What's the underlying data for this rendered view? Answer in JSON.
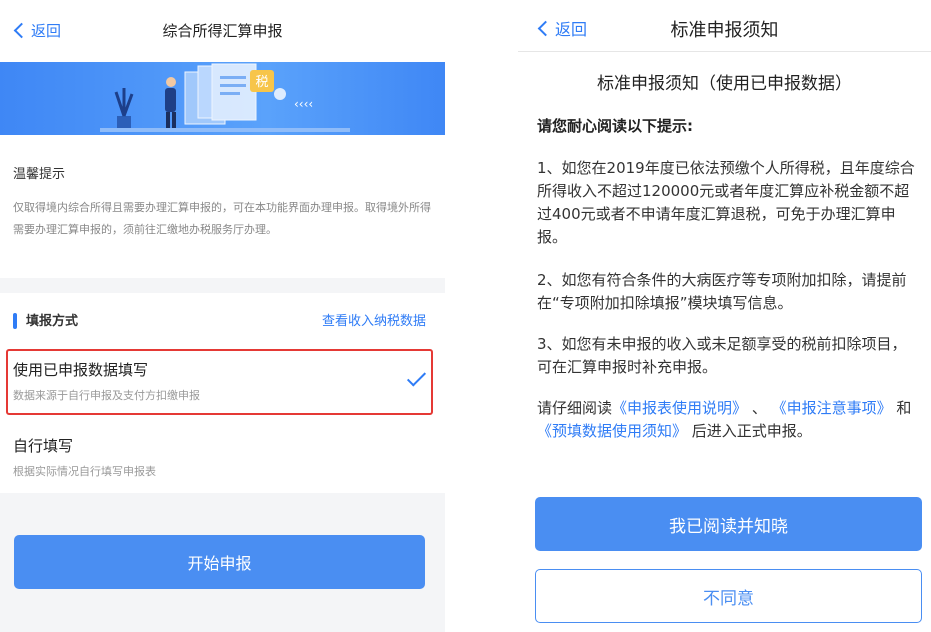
{
  "left": {
    "nav": {
      "back_label": "返回",
      "title": "综合所得汇算申报"
    },
    "banner": {
      "badge": "税"
    },
    "tips": {
      "title": "温馨提示",
      "body": "仅取得境内综合所得且需要办理汇算申报的，可在本功能界面办理申报。取得境外所得需要办理汇算申报的，须前往汇缴地办税服务厅办理。"
    },
    "method": {
      "label": "填报方式",
      "link": "查看收入纳税数据",
      "options": [
        {
          "title": "使用已申报数据填写",
          "sub": "数据来源于自行申报及支付方扣缴申报",
          "selected": true
        },
        {
          "title": "自行填写",
          "sub": "根据实际情况自行填写申报表",
          "selected": false
        }
      ]
    },
    "start_button": "开始申报"
  },
  "right": {
    "nav": {
      "back_label": "返回",
      "title": "标准申报须知"
    },
    "doc_title": "标准申报须知（使用已申报数据）",
    "intro": "请您耐心阅读以下提示:",
    "paragraphs": [
      "1、如您在2019年度已依法预缴个人所得税，且年度综合所得收入不超过120000元或者年度汇算应补税金额不超过400元或者不申请年度汇算退税，可免于办理汇算申报。",
      "2、如您有符合条件的大病医疗等专项附加扣除，请提前在“专项附加扣除填报”模块填写信息。",
      "3、如您有未申报的收入或未足额享受的税前扣除项目，可在汇算申报时补充申报。"
    ],
    "final": {
      "pre": "请仔细阅读",
      "link1": "《申报表使用说明》",
      "sep1": "、",
      "link2": "《申报注意事项》",
      "mid": "和",
      "link3": "《预填数据使用须知》",
      "post": "后进入正式申报。"
    },
    "agree_button": "我已阅读并知晓",
    "disagree_button": "不同意"
  },
  "colors": {
    "accent": "#2f7cf6",
    "button": "#4a8ef2",
    "highlight": "#e53935"
  }
}
